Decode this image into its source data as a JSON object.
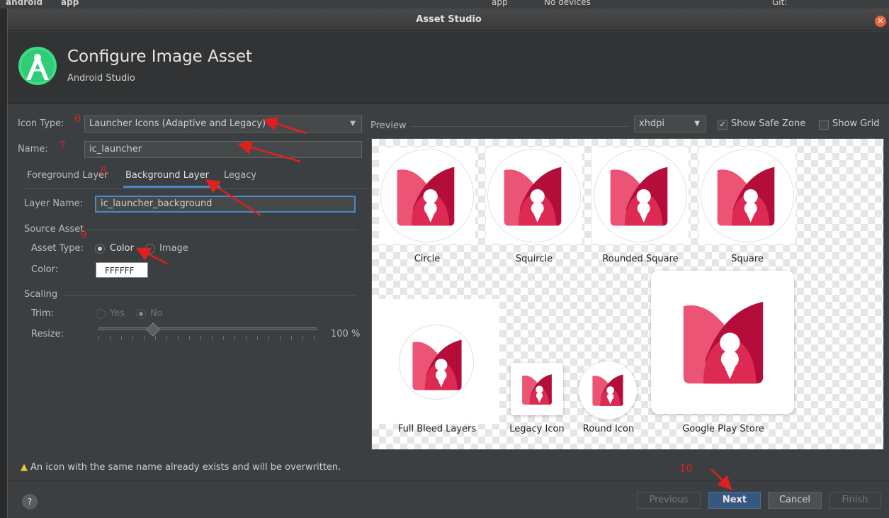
{
  "ide": {
    "breadcrumb_project": "android",
    "breadcrumb_module": "app",
    "run_config": "app",
    "device": "No devices",
    "vcs": "Git:"
  },
  "dialog": {
    "window_title": "Asset Studio",
    "header_title": "Configure Image Asset",
    "header_subtitle": "Android Studio"
  },
  "form": {
    "icon_type_label": "Icon Type:",
    "icon_type_value": "Launcher Icons (Adaptive and Legacy)",
    "name_label": "Name:",
    "name_value": "ic_launcher",
    "tabs": [
      {
        "label": "Foreground Layer"
      },
      {
        "label": "Background Layer"
      },
      {
        "label": "Legacy"
      }
    ],
    "layer_name_label": "Layer Name:",
    "layer_name_value": "ic_launcher_background",
    "source_asset_label": "Source Asset",
    "asset_type_label": "Asset Type:",
    "asset_type_color": "Color",
    "asset_type_image": "Image",
    "color_label": "Color:",
    "color_value": "FFFFFF",
    "scaling_label": "Scaling",
    "trim_label": "Trim:",
    "trim_yes": "Yes",
    "trim_no": "No",
    "resize_label": "Resize:",
    "resize_value": "100 %",
    "resize_percent": 100
  },
  "preview": {
    "label": "Preview",
    "density": "xhdpi",
    "show_safe_zone": "Show Safe Zone",
    "show_safe_zone_checked": true,
    "show_grid": "Show Grid",
    "show_grid_checked": false,
    "captions": {
      "circle": "Circle",
      "squircle": "Squircle",
      "rounded_square": "Rounded Square",
      "square": "Square",
      "full_bleed": "Full Bleed Layers",
      "legacy": "Legacy Icon",
      "round": "Round Icon",
      "play_store": "Google Play Store"
    }
  },
  "annotations": [
    "6",
    "7",
    "8",
    "9",
    "10"
  ],
  "warning": "An icon with the same name already exists and will be overwritten.",
  "buttons": {
    "help": "?",
    "previous": "Previous",
    "next": "Next",
    "cancel": "Cancel",
    "finish": "Finish"
  },
  "colors": {
    "accent_blue": "#4a88c7",
    "icon_light": "#ec5476",
    "icon_mid": "#dc2a52",
    "icon_dark": "#b40d3a",
    "annotation_red": "#e02020"
  }
}
